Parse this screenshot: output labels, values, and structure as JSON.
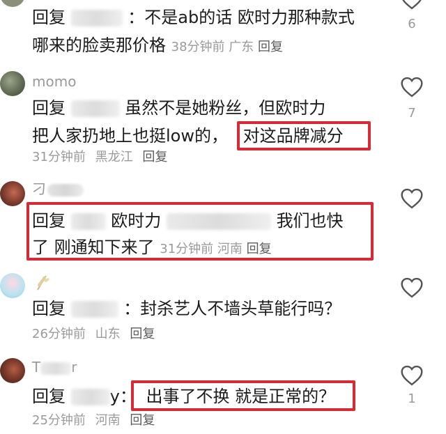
{
  "comments": [
    {
      "body_lines": [
        "回复",
        "：不是ab的话 欧时力那种款式",
        "哪来的脸卖那价格"
      ],
      "time": "38分钟前",
      "location": "广东",
      "reply": "回复",
      "likes": "6"
    },
    {
      "username": "momo",
      "body_lines": [
        "回复",
        "虽然不是她粉丝，但欧时力",
        "把人家扔地上也挺low的，",
        "对这品牌减分"
      ],
      "time": "31分钟前",
      "location": "黑龙江",
      "reply": "回复",
      "likes": "7"
    },
    {
      "username": "刁",
      "body_lines": [
        "回复",
        "欧时力",
        "我们也快",
        "了 刚通知下来了"
      ],
      "time": "31分钟前",
      "location": "河南",
      "reply": "回复",
      "likes": ""
    },
    {
      "body_lines": [
        "回复",
        "：封杀艺人不墙头草能行吗？"
      ],
      "time": "26分钟前",
      "location": "山东",
      "reply": "回复",
      "likes": ""
    },
    {
      "username": "T",
      "username_tail": "r",
      "body_lines": [
        "回复",
        "y：",
        "出事了不换  就是正常的？"
      ],
      "time": "25分钟前",
      "location": "河南",
      "reply": "回复",
      "likes": "1"
    }
  ],
  "icons": {
    "like": "heart-outline-icon"
  },
  "colors": {
    "highlight": "#d62a35",
    "meta": "#9a9a9a"
  }
}
